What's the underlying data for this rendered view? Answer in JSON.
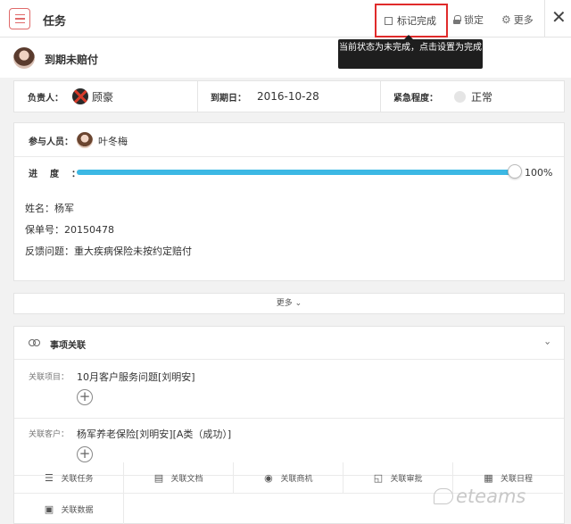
{
  "topbar": {
    "title": "任务",
    "mark_complete": "标记完成",
    "lock": "锁定",
    "more": "更多",
    "close": "✕"
  },
  "tooltip": "当前状态为未完成，点击设置为完成",
  "task": {
    "title": "到期未赔付"
  },
  "meta": {
    "owner_label": "负责人：",
    "owner_name": "顾豪",
    "due_label": "到期日：",
    "due_date": "2016-10-28",
    "urgency_label": "紧急程度：",
    "urgency_value": "正常"
  },
  "participants": {
    "label": "参与人员：",
    "name": "叶冬梅"
  },
  "progress": {
    "label": "进度：",
    "value": 100,
    "text": "100%"
  },
  "description": [
    "姓名：杨军",
    "保单号：20150478",
    "反馈问题：重大疾病保险未按约定赔付"
  ],
  "more_bar": "更多 ⌄",
  "associations": {
    "title": "事项关联",
    "project_label": "关联项目：",
    "project_value": "10月客户服务问题[刘明安]",
    "customer_label": "关联客户：",
    "customer_value": "杨军养老保险[刘明安][A类（成功）]",
    "actions": [
      {
        "label": "关联任务",
        "icon": "list-icon"
      },
      {
        "label": "关联文档",
        "icon": "document-icon"
      },
      {
        "label": "关联商机",
        "icon": "opportunity-icon"
      },
      {
        "label": "关联审批",
        "icon": "approval-icon"
      },
      {
        "label": "关联日程",
        "icon": "calendar-icon"
      },
      {
        "label": "关联数据",
        "icon": "data-icon"
      }
    ]
  },
  "watermark": "eteams",
  "colors": {
    "accent": "#3cb8e4",
    "highlight_border": "#e02b2b",
    "menu_icon": "#e06a6a"
  }
}
